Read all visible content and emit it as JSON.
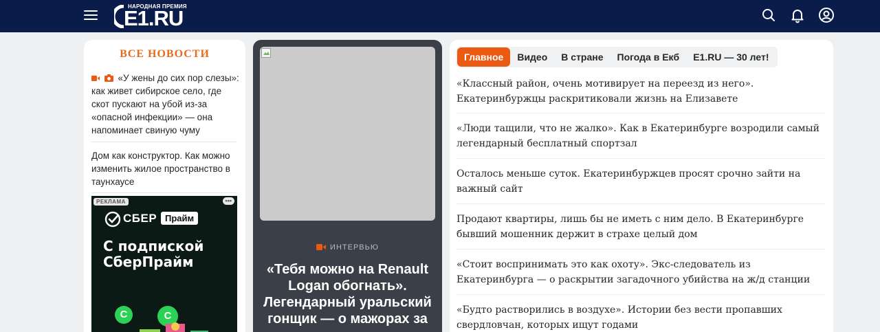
{
  "header": {
    "logo_prize": "НАРОДНАЯ ПРЕМИЯ",
    "logo_text": "E1.RU",
    "icons": [
      "menu-icon",
      "search-icon",
      "bell-icon",
      "user-icon"
    ],
    "colors": {
      "bg": "#0a1d4a",
      "accent": "#ea5a12"
    }
  },
  "left": {
    "title": "ВСЕ НОВОСТИ",
    "items": [
      {
        "text": "«У жены до сих пор слезы»: как живет сибирское село, где скот пускают на убой из-за «опасной инфекции» — она напоминает свиную чуму",
        "icons": [
          "video-icon",
          "photo-icon"
        ]
      },
      {
        "text": "Дом как конструктор. Как можно изменить жилое пространство в таунхаусе",
        "icons": []
      }
    ],
    "ad": {
      "label": "РЕКЛАМА",
      "dots": "•••",
      "brand": "СБЕР",
      "badge": "Прайм",
      "headline_1": "С подпиской",
      "headline_2": "СберПрайм",
      "coin_symbol": "C"
    }
  },
  "middle": {
    "tag": "ИНТЕРВЬЮ",
    "title": "«Тебя можно на Renault Logan обогнать». Легендарный уральский гонщик — о мажорах за"
  },
  "right": {
    "tabs": [
      {
        "label": "Главное",
        "active": true
      },
      {
        "label": "Видео",
        "active": false
      },
      {
        "label": "В стране",
        "active": false
      },
      {
        "label": "Погода в Екб",
        "active": false
      },
      {
        "label": "E1.RU — 30 лет!",
        "active": false
      }
    ],
    "items": [
      "«Классный район, очень мотивирует на переезд из него». Екатеринбуржцы раскритиковали жизнь на Елизавете",
      "«Люди тащили, что не жалко». Как в Екатеринбурге возродили самый легендарный бесплатный спортзал",
      "Осталось меньше суток. Екатеринбуржцев просят срочно зайти на важный сайт",
      "Продают квартиры, лишь бы не иметь с ним дело. В Екатеринбурге бывший мошенник держит в страхе целый дом",
      "«Стоит воспринимать это как охоту». Экс-следователь из Екатеринбурга — о раскрытии загадочного убийства на ж/д станции",
      "«Будто растворились в воздухе». Истории без вести пропавших свердловчан, которых ищут годами"
    ]
  }
}
